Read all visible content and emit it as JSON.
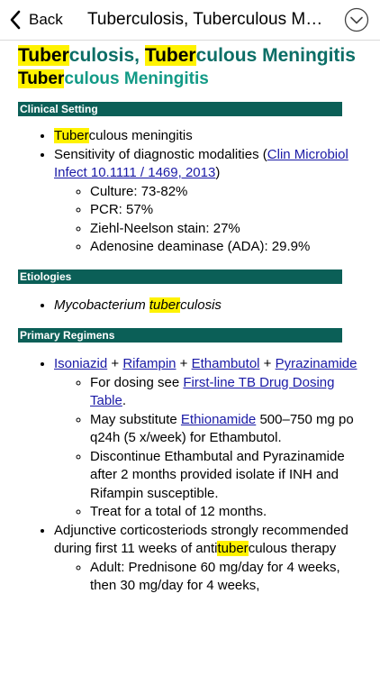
{
  "nav": {
    "back_label": "Back",
    "title": "Tuberculosis, Tuberculous Meningitis"
  },
  "header": {
    "h1_hl1": "Tuber",
    "h1_part1": "culosis, ",
    "h1_hl2": "Tuber",
    "h1_part2": "culous Meningitis",
    "h2_hl": "Tuber",
    "h2_rest": "culous Meningitis"
  },
  "sections": {
    "clinical_setting": {
      "title": "Clinical Setting",
      "item1_hl": "Tuber",
      "item1_rest": "culous meningitis",
      "item2_text": "Sensitivity of diagnostic modalities (",
      "item2_link": "Clin Microbiol Infect 10.1111 / 1469, 2013",
      "item2_close": ")",
      "sub": [
        "Culture: 73-82%",
        "PCR: 57%",
        "Ziehl-Neelson stain: 27%",
        "Adenosine deaminase (ADA): 29.9%"
      ]
    },
    "etiologies": {
      "title": "Etiologies",
      "item_prefix": "Mycobacterium ",
      "item_hl": "tuber",
      "item_suffix": "culosis"
    },
    "primary_regimens": {
      "title": "Primary Regimens",
      "drugs": [
        "Isoniazid",
        "Rifampin",
        "Ethambutol",
        "Pyrazinamide"
      ],
      "plus": " + ",
      "dosing_prefix": "For dosing see ",
      "dosing_link": "First-line TB Drug Dosing Table",
      "dosing_suffix": ".",
      "subst_prefix": "May substitute ",
      "subst_link": "Ethionamide",
      "subst_suffix": " 500–750 mg po q24h (5 x/week) for Ethambutol.",
      "discontinue": "Discontinue Ethambutal and Pyrazinamide after 2 months provided isolate if INH and Rifampin susceptible.",
      "treat": "Treat for a total of 12 months.",
      "adj_prefix": "Adjunctive corticosteriods strongly recommended during first 11 weeks of anti",
      "adj_hl": "tuber",
      "adj_suffix": "culous therapy",
      "adult": "Adult: Prednisone 60 mg/day for 4 weeks, then 30 mg/day for 4 weeks,"
    }
  },
  "colors": {
    "heading": "#0b6e66",
    "subheading": "#129a86",
    "section_bar": "#0b5f57",
    "highlight": "#fff200",
    "link": "#1a1aa6"
  },
  "icons": {
    "back": "chevron-left-icon",
    "menu": "chevron-down-circle-icon"
  }
}
